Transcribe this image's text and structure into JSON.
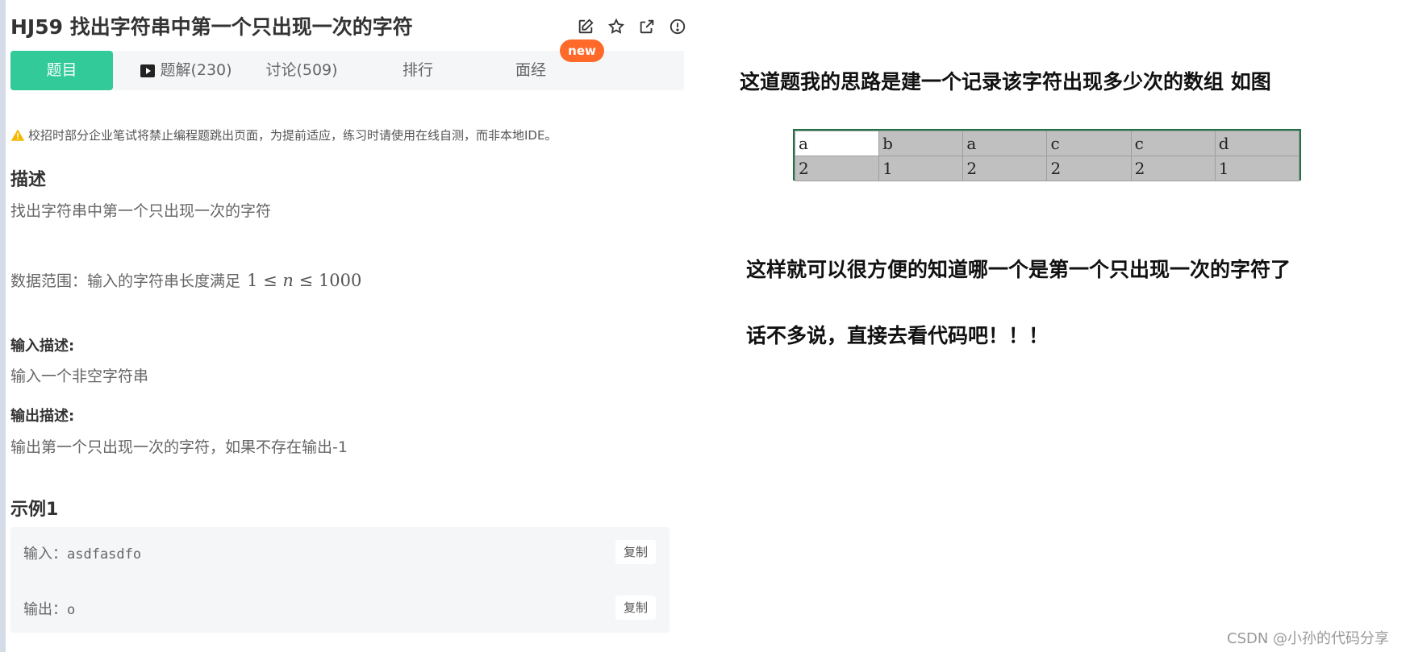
{
  "problem": {
    "title": "HJ59  找出字符串中第一个只出现一次的字符",
    "tabs": {
      "problem": "题目",
      "solutions": "题解(230)",
      "discussion": "讨论(509)",
      "ranking": "排行",
      "interview": "面经"
    },
    "new_badge": "new",
    "warning": "校招时部分企业笔试将禁止编程题跳出页面，为提前适应，练习时请使用在线自测，而非本地IDE。",
    "description_heading": "描述",
    "description": "找出字符串中第一个只出现一次的字符",
    "range_label": "数据范围：输入的字符串长度满足",
    "range_math": {
      "low": "1",
      "op1": "≤",
      "var": "n",
      "op2": "≤",
      "high": "1000"
    },
    "input_heading": "输入描述:",
    "input_desc": "输入一个非空字符串",
    "output_heading": "输出描述:",
    "output_desc": "输出第一个只出现一次的字符，如果不存在输出-1",
    "example_heading": "示例1",
    "example": {
      "input_label": "输入：",
      "input_value": "asdfasdfo",
      "output_label": "输出：",
      "output_value": "o",
      "copy_label": "复制"
    }
  },
  "notes": {
    "line1": "这道题我的思路是建一个记录该字符出现多少次的数组 如图",
    "line2": "这样就可以很方便的知道哪一个是第一个只出现一次的字符了",
    "line3": "话不多说，直接去看代码吧！！！"
  },
  "sheet": {
    "row1": [
      "a",
      "b",
      "a",
      "c",
      "c",
      "d"
    ],
    "row2": [
      "2",
      "1",
      "2",
      "2",
      "2",
      "1"
    ]
  },
  "watermark": "CSDN @小孙的代码分享",
  "colors": {
    "accent": "#32ca99",
    "new_badge": "#ff6a2a",
    "sheet_border": "#217346",
    "warning": "#f5b800"
  },
  "icons": [
    "edit-icon",
    "star-icon",
    "share-icon",
    "info-icon",
    "play-icon",
    "warning-icon"
  ]
}
